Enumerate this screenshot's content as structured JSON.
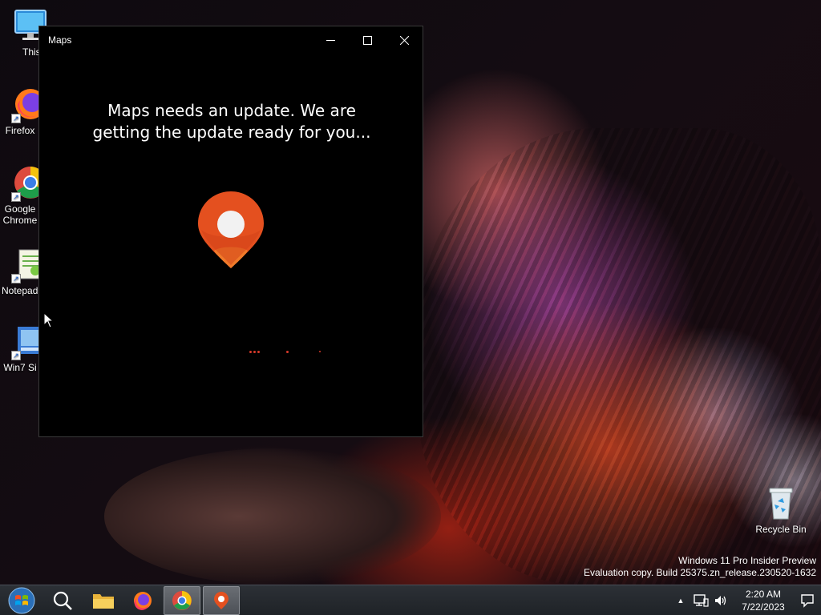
{
  "desktop": {
    "icons": [
      {
        "label": "This PC",
        "icon": "monitor-icon"
      },
      {
        "label": "Firefox",
        "icon": "firefox-icon"
      },
      {
        "label": "Google Chrome",
        "icon": "chrome-icon"
      },
      {
        "label": "Notepad++",
        "icon": "notepad-icon"
      },
      {
        "label": "Win7 Si",
        "icon": "win7-icon"
      },
      {
        "label": "Recycle Bin",
        "icon": "recycle-bin-icon"
      }
    ]
  },
  "maps_window": {
    "title": "Maps",
    "message": "Maps needs an update. We are getting the update ready for you...",
    "accent": "#e4501f",
    "loader_color": "#d93a2a"
  },
  "watermark": {
    "line1": "Windows 11 Pro Insider Preview",
    "line2": "Evaluation copy. Build 25375.zn_release.230520-1632"
  },
  "taskbar": {
    "apps": [
      {
        "name": "start",
        "icon": "windows-orb-icon"
      },
      {
        "name": "search",
        "icon": "search-icon"
      },
      {
        "name": "file-explorer",
        "icon": "folder-icon"
      },
      {
        "name": "firefox",
        "icon": "firefox-icon"
      },
      {
        "name": "chrome",
        "icon": "chrome-icon"
      },
      {
        "name": "maps",
        "icon": "maps-pin-icon",
        "active": true
      }
    ],
    "clock": {
      "time": "2:20 AM",
      "date": "7/22/2023"
    }
  }
}
